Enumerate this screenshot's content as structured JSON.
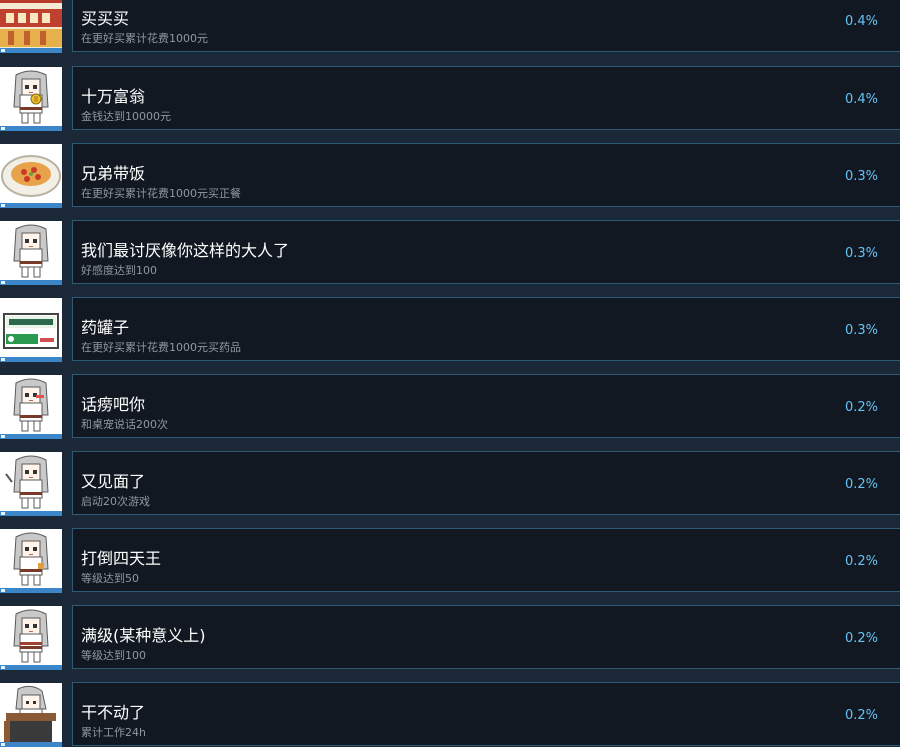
{
  "achievements": [
    {
      "title": "买买买",
      "description": "在更好买累计花费1000元",
      "percent": "0.4%",
      "icon": "pixel-sign-icon"
    },
    {
      "title": "十万富翁",
      "description": "金钱达到10000元",
      "percent": "0.4%",
      "icon": "chibi-girl-money-icon"
    },
    {
      "title": "兄弟带饭",
      "description": "在更好买累计花费1000元买正餐",
      "percent": "0.3%",
      "icon": "food-plate-icon"
    },
    {
      "title": "我们最讨厌像你这样的大人了",
      "description": "好感度达到100",
      "percent": "0.3%",
      "icon": "chibi-girl-icon"
    },
    {
      "title": "药罐子",
      "description": "在更好买累计花费1000元买药品",
      "percent": "0.3%",
      "icon": "medicine-box-icon"
    },
    {
      "title": "话痨吧你",
      "description": "和桌宠说话200次",
      "percent": "0.2%",
      "icon": "chibi-girl-talk-icon"
    },
    {
      "title": "又见面了",
      "description": "启动20次游戏",
      "percent": "0.2%",
      "icon": "chibi-girl-wave-icon"
    },
    {
      "title": "打倒四天王",
      "description": "等级达到50",
      "percent": "0.2%",
      "icon": "chibi-girl-fight-icon"
    },
    {
      "title": "满级(某种意义上)",
      "description": "等级达到100",
      "percent": "0.2%",
      "icon": "chibi-girl-maxlevel-icon"
    },
    {
      "title": "干不动了",
      "description": "累计工作24h",
      "percent": "0.2%",
      "icon": "chibi-girl-desk-icon"
    }
  ]
}
